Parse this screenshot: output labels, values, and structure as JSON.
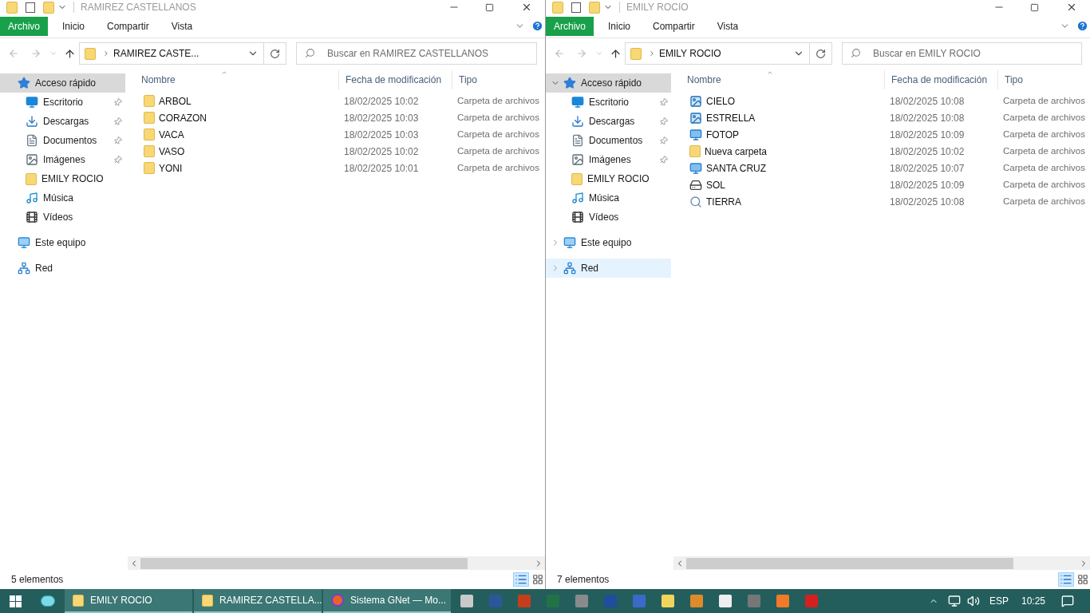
{
  "windows": [
    {
      "title": "RAMIREZ CASTELLANOS",
      "ribbon_tabs": [
        {
          "label": "Archivo",
          "selected": true
        },
        {
          "label": "Inicio",
          "selected": false
        },
        {
          "label": "Compartir",
          "selected": false
        },
        {
          "label": "Vista",
          "selected": false
        }
      ],
      "address": "RAMIREZ CASTE...",
      "search": {
        "placeholder": "Buscar en RAMIREZ CASTELLANOS"
      },
      "sidebar": [
        {
          "label": "Acceso rápido",
          "kind": "quick",
          "selected": true,
          "children": [
            {
              "label": "Escritorio",
              "kind": "desktop",
              "pinned": true
            },
            {
              "label": "Descargas",
              "kind": "downloads",
              "pinned": true
            },
            {
              "label": "Documentos",
              "kind": "documents",
              "pinned": true
            },
            {
              "label": "Imágenes",
              "kind": "pictures",
              "pinned": true
            },
            {
              "label": "EMILY ROCIO",
              "kind": "folder",
              "pinned": false
            },
            {
              "label": "Música",
              "kind": "music",
              "pinned": false
            },
            {
              "label": "Vídeos",
              "kind": "videos",
              "pinned": false
            }
          ]
        },
        {
          "label": "Este equipo",
          "kind": "pc",
          "selected": false,
          "hovered": false
        },
        {
          "label": "Red",
          "kind": "network",
          "selected": false,
          "hovered": false
        }
      ],
      "columns": [
        "Nombre",
        "Fecha de modificación",
        "Tipo"
      ],
      "files": [
        {
          "name": "ARBOL",
          "kind": "folder",
          "date": "18/02/2025 10:02",
          "type": "Carpeta de archivos"
        },
        {
          "name": "CORAZON",
          "kind": "folder",
          "date": "18/02/2025 10:03",
          "type": "Carpeta de archivos"
        },
        {
          "name": "VACA",
          "kind": "folder",
          "date": "18/02/2025 10:03",
          "type": "Carpeta de archivos"
        },
        {
          "name": "VASO",
          "kind": "folder",
          "date": "18/02/2025 10:02",
          "type": "Carpeta de archivos"
        },
        {
          "name": "YONI",
          "kind": "folder",
          "date": "18/02/2025 10:01",
          "type": "Carpeta de archivos"
        }
      ],
      "status": "5 elementos"
    },
    {
      "title": "EMILY ROCIO",
      "ribbon_tabs": [
        {
          "label": "Archivo",
          "selected": true
        },
        {
          "label": "Inicio",
          "selected": false
        },
        {
          "label": "Compartir",
          "selected": false
        },
        {
          "label": "Vista",
          "selected": false
        }
      ],
      "address": "EMILY ROCIO",
      "search": {
        "placeholder": "Buscar en EMILY ROCIO"
      },
      "sidebar": [
        {
          "label": "Acceso rápido",
          "kind": "quick",
          "selected": true,
          "expanded": true,
          "children": [
            {
              "label": "Escritorio",
              "kind": "desktop",
              "pinned": true
            },
            {
              "label": "Descargas",
              "kind": "downloads",
              "pinned": true
            },
            {
              "label": "Documentos",
              "kind": "documents",
              "pinned": true
            },
            {
              "label": "Imágenes",
              "kind": "pictures",
              "pinned": true
            },
            {
              "label": "EMILY ROCIO",
              "kind": "folder",
              "pinned": false
            },
            {
              "label": "Música",
              "kind": "music",
              "pinned": false
            },
            {
              "label": "Vídeos",
              "kind": "videos",
              "pinned": false
            }
          ]
        },
        {
          "label": "Este equipo",
          "kind": "pc",
          "selected": false,
          "hovered": false,
          "expanded": false
        },
        {
          "label": "Red",
          "kind": "network",
          "selected": false,
          "hovered": true,
          "expanded": false
        }
      ],
      "columns": [
        "Nombre",
        "Fecha de modificación",
        "Tipo"
      ],
      "files": [
        {
          "name": "CIELO",
          "kind": "image",
          "date": "18/02/2025 10:08",
          "type": "Carpeta de archivos"
        },
        {
          "name": "ESTRELLA",
          "kind": "image",
          "date": "18/02/2025 10:08",
          "type": "Carpeta de archivos"
        },
        {
          "name": "FOTOP",
          "kind": "netfolder",
          "date": "18/02/2025 10:09",
          "type": "Carpeta de archivos"
        },
        {
          "name": "Nueva carpeta",
          "kind": "folder",
          "date": "18/02/2025 10:02",
          "type": "Carpeta de archivos"
        },
        {
          "name": "SANTA CRUZ",
          "kind": "netfolder",
          "date": "18/02/2025 10:07",
          "type": "Carpeta de archivos"
        },
        {
          "name": "SOL",
          "kind": "drive",
          "date": "18/02/2025 10:09",
          "type": "Carpeta de archivos"
        },
        {
          "name": "TIERRA",
          "kind": "search",
          "date": "18/02/2025 10:08",
          "type": "Carpeta de archivos"
        }
      ],
      "status": "7 elementos"
    }
  ],
  "taskbar": {
    "tasks": [
      {
        "label": "EMILY ROCIO",
        "kind": "folder"
      },
      {
        "label": "RAMIREZ CASTELLA...",
        "kind": "folder"
      },
      {
        "label": "Sistema GNet — Mo...",
        "kind": "browser"
      }
    ],
    "language": "ESP",
    "time": "10:25"
  }
}
